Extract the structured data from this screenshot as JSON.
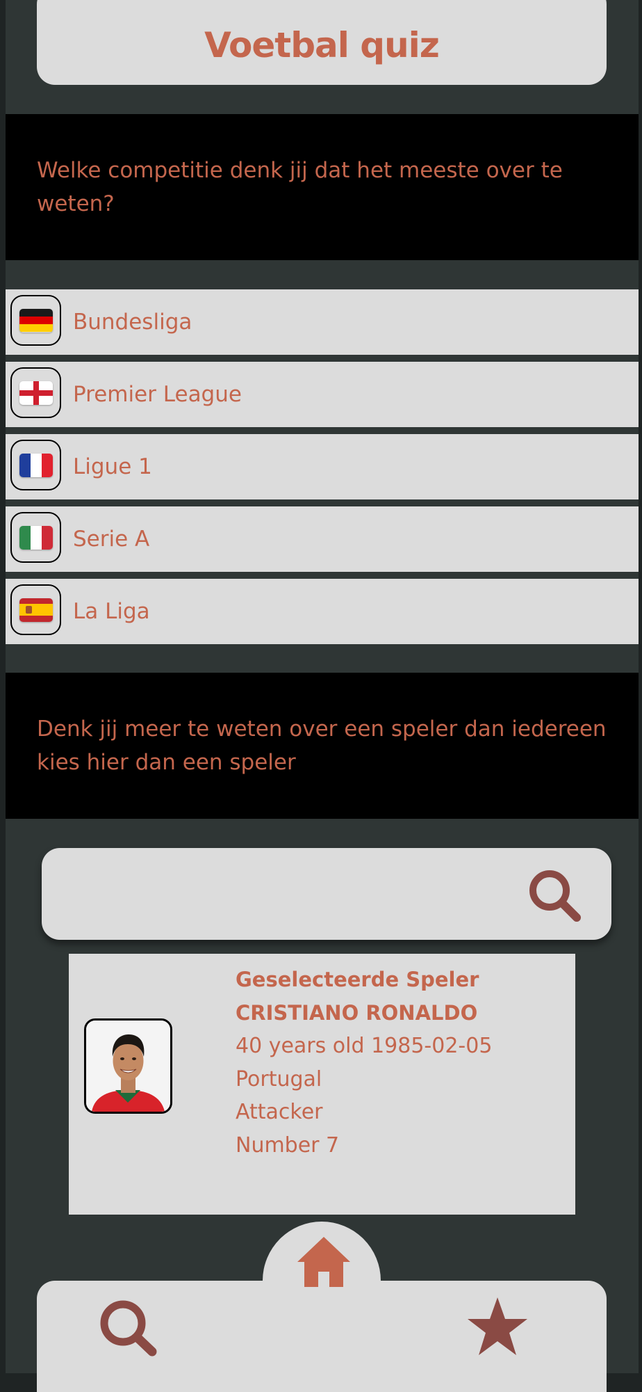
{
  "header": {
    "title": "Voetbal quiz"
  },
  "competition_prompt": "Welke competitie denk jij dat  het meeste over te weten?",
  "leagues": [
    {
      "label": "Bundesliga",
      "flag": "germany-flag"
    },
    {
      "label": "Premier League",
      "flag": "england-flag"
    },
    {
      "label": "Ligue 1",
      "flag": "france-flag"
    },
    {
      "label": "Serie A",
      "flag": "italy-flag"
    },
    {
      "label": "La Liga",
      "flag": "spain-flag"
    }
  ],
  "player_prompt": "Denk jij meer te weten over een speler dan iedereen kies hier dan een speler",
  "search": {
    "placeholder": "",
    "icon": "search-icon"
  },
  "selected_player": {
    "heading": "Geselecteerde Speler",
    "name": "CRISTIANO RONALDO",
    "age_line": "40 years old 1985-02-05",
    "country": "Portugal",
    "position": "Attacker",
    "number": "Number 7"
  },
  "nav": {
    "items": [
      {
        "name": "search",
        "icon": "search-icon"
      },
      {
        "name": "home",
        "icon": "home-icon"
      },
      {
        "name": "favorites",
        "icon": "star-icon"
      }
    ]
  },
  "colors": {
    "accent": "#c4664d",
    "icon_dark": "#8a4a44",
    "panel": "#dcdcdc",
    "background": "#2f3635",
    "banner": "#000000"
  }
}
